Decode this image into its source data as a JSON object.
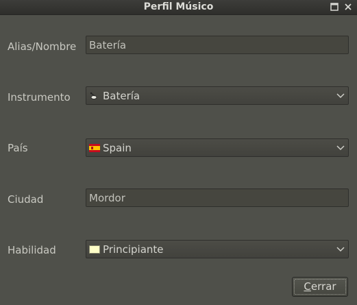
{
  "window": {
    "title": "Perfil Músico"
  },
  "fields": {
    "alias": {
      "label": "Alias/Nombre",
      "value": "Batería"
    },
    "instrumento": {
      "label": "Instrumento",
      "value": "Batería",
      "icon": "drum-icon"
    },
    "pais": {
      "label": "País",
      "value": "Spain",
      "icon": "spain-flag-icon"
    },
    "ciudad": {
      "label": "Ciudad",
      "value": "Mordor"
    },
    "habilidad": {
      "label": "Habilidad",
      "value": "Principiante",
      "icon": "skill-swatch-icon"
    }
  },
  "buttons": {
    "close_first": "C",
    "close_rest": "errar"
  },
  "colors": {
    "background": "#4f504a",
    "titlebar": "#2e2e2b",
    "text": "#c9c9c2"
  }
}
